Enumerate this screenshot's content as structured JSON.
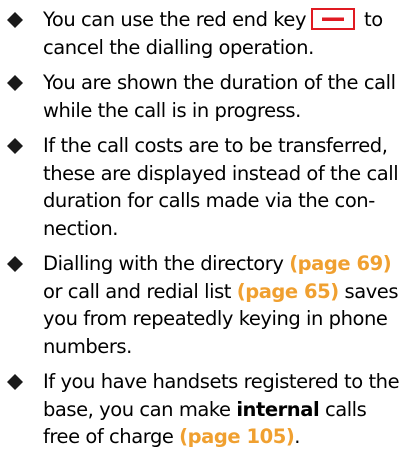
{
  "bullets": [
    {
      "before": "You can use the red end key",
      "after": "to cancel the dialling operation.",
      "key_icon": "red-end-key-icon"
    },
    {
      "text": "You are shown the duration of the call while the call is in progress."
    },
    {
      "text": "If the call costs are to be transferred, these are displayed instead of the call duration for calls made via the con-nection."
    },
    {
      "t1": "Dialling with the directory",
      "ref1": "(page 69)",
      "t2": "or call and redial list",
      "ref2": "(page 65)",
      "t3": "saves you from repeatedly keying in phone numbers."
    },
    {
      "t1": "If you have handsets registered to the base, you can make",
      "bold": "internal",
      "t2": "calls free of charge",
      "ref": "(page 105)",
      "t3": "."
    }
  ],
  "colors": {
    "text": "#000000",
    "bullet": "#1a1a1a",
    "reference": "#f0a030",
    "end_key_red": "#e01a22"
  },
  "icons": {
    "bullet": "diamond-bullet-icon",
    "end_key": "red-end-key-icon"
  }
}
